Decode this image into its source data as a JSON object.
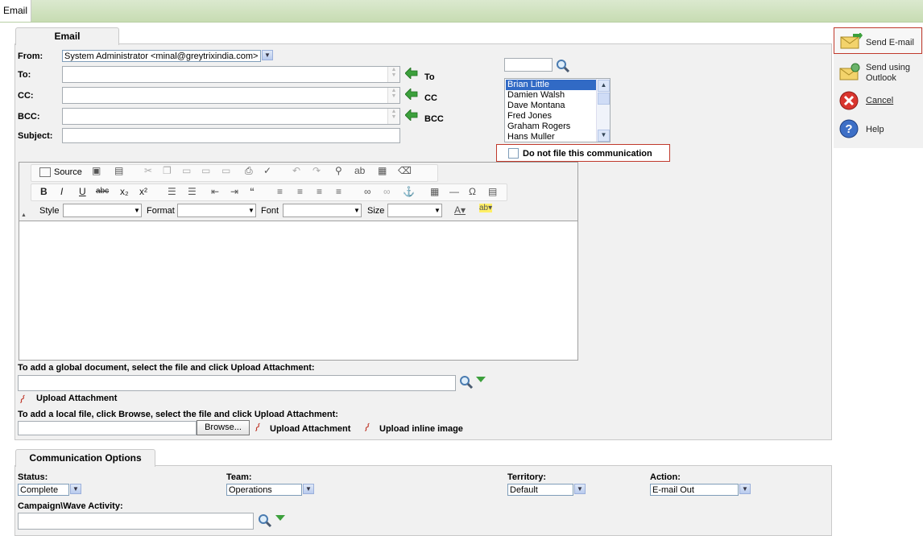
{
  "window": {
    "title_tab": "Email"
  },
  "email_tab": {
    "label": "Email"
  },
  "form": {
    "from_label": "From:",
    "from_value": "System Administrator <minal@greytrixindia.com>",
    "to_label": "To:",
    "cc_label": "CC:",
    "bcc_label": "BCC:",
    "subject_label": "Subject:",
    "to_button": "To",
    "cc_button": "CC",
    "bcc_button": "BCC"
  },
  "contacts": {
    "items": [
      "Brian Little",
      "Damien Walsh",
      "Dave Montana",
      "Fred Jones",
      "Graham Rogers",
      "Hans Muller"
    ],
    "selected": "Brian Little"
  },
  "no_file": {
    "label": "Do not file this communication",
    "checked": false
  },
  "editor": {
    "source_label": "Source",
    "style_label": "Style",
    "format_label": "Format",
    "font_label": "Font",
    "size_label": "Size"
  },
  "attachments": {
    "global_text": "To add a global document, select the file and click Upload Attachment:",
    "upload_attachment": "Upload Attachment",
    "local_text": "To add a local file, click Browse, select the file and click Upload Attachment:",
    "browse": "Browse...",
    "upload_attachment2": "Upload Attachment",
    "upload_inline": "Upload inline image"
  },
  "comm_options": {
    "tab_label": "Communication Options",
    "status_label": "Status:",
    "status_value": "Complete",
    "team_label": "Team:",
    "team_value": "Operations",
    "territory_label": "Territory:",
    "territory_value": "Default",
    "action_label": "Action:",
    "action_value": "E-mail Out",
    "campaign_label": "Campaign\\Wave Activity:"
  },
  "sidebar": {
    "send_email": "Send E-mail",
    "send_outlook_1": "Send using",
    "send_outlook_2": "Outlook",
    "cancel": "Cancel",
    "help": "Help"
  },
  "colors": {
    "topbar": "#c7dcb2",
    "panel": "#f1f1f1",
    "highlight_border": "#c0392b",
    "selection": "#316ac5"
  }
}
